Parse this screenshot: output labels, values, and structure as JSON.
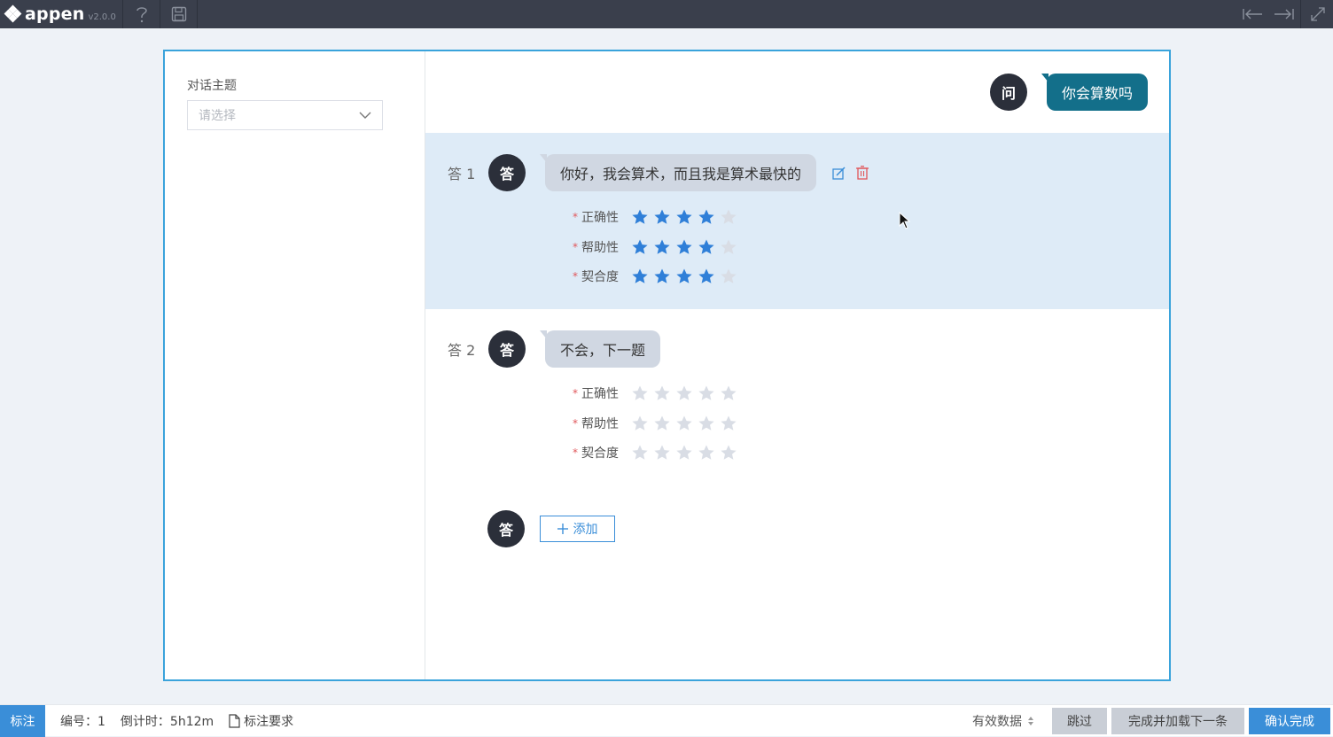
{
  "app": {
    "name": "appen",
    "version": "v2.0.0"
  },
  "left_panel": {
    "topic_label": "对话主题",
    "topic_placeholder": "请选择"
  },
  "question": {
    "avatar": "问",
    "text": "你会算数吗"
  },
  "answers": [
    {
      "number": "答 1",
      "avatar": "答",
      "text": "你好，我会算术，而且我是算术最快的",
      "ratings": [
        {
          "label": "正确性",
          "value": 4,
          "max": 5
        },
        {
          "label": "帮助性",
          "value": 4,
          "max": 5
        },
        {
          "label": "契合度",
          "value": 4,
          "max": 5
        }
      ]
    },
    {
      "number": "答 2",
      "avatar": "答",
      "text": "不会，下一题",
      "ratings": [
        {
          "label": "正确性",
          "value": 0,
          "max": 5
        },
        {
          "label": "帮助性",
          "value": 0,
          "max": 5
        },
        {
          "label": "契合度",
          "value": 0,
          "max": 5
        }
      ]
    }
  ],
  "add_answer": {
    "avatar": "答",
    "button_label": "添加"
  },
  "bottom": {
    "mode_tab": "标注",
    "id_text": "编号：1",
    "timer_text": "倒计时：5h12m",
    "requirements_label": "标注要求",
    "valid_data_label": "有效数据",
    "skip_label": "跳过",
    "next_label": "完成并加载下一条",
    "confirm_label": "确认完成"
  },
  "colors": {
    "accent": "#3a8ed8",
    "question_bubble": "#136f8a",
    "star_on": "#2f7fd8",
    "star_off": "#d9dde5",
    "active_row": "#deebf7"
  }
}
